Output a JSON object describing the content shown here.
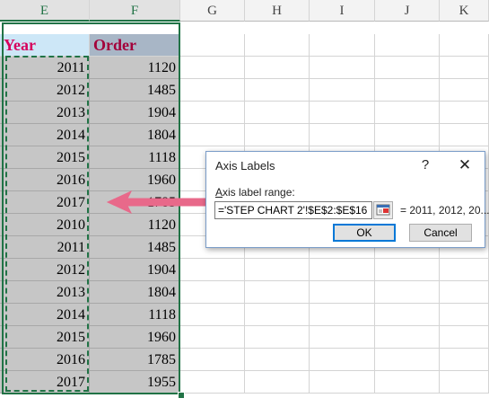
{
  "columns": [
    "E",
    "F",
    "G",
    "H",
    "I",
    "J",
    "K"
  ],
  "table": {
    "header": {
      "year": "Year",
      "order": "Order"
    },
    "rows": [
      [
        "2011",
        "1120"
      ],
      [
        "2012",
        "1485"
      ],
      [
        "2013",
        "1904"
      ],
      [
        "2014",
        "1804"
      ],
      [
        "2015",
        "1118"
      ],
      [
        "2016",
        "1960"
      ],
      [
        "2017",
        "1785"
      ],
      [
        "2010",
        "1120"
      ],
      [
        "2011",
        "1485"
      ],
      [
        "2012",
        "1904"
      ],
      [
        "2013",
        "1804"
      ],
      [
        "2014",
        "1118"
      ],
      [
        "2015",
        "1960"
      ],
      [
        "2016",
        "1785"
      ],
      [
        "2017",
        "1955"
      ]
    ]
  },
  "dialog": {
    "title": "Axis Labels",
    "help": "?",
    "close": "✕",
    "range_label_prefix": "",
    "range_label_accel": "A",
    "range_label_rest": "xis label range:",
    "range_value": "='STEP CHART 2'!$E$2:$E$16",
    "preview": "= 2011, 2012, 20...",
    "ok_label": "OK",
    "cancel_label": "Cancel"
  },
  "colors": {
    "selection": "#217346",
    "year_header_bg": "#cde7f7",
    "order_header_bg": "#a8b6c6",
    "header_text": "#d6005c",
    "arrow": "#e8698a",
    "data_bg": "#c6c6c6"
  },
  "icons": {
    "collapse_dialog": "range-collapse-icon",
    "arrow": "left-arrow-icon"
  }
}
